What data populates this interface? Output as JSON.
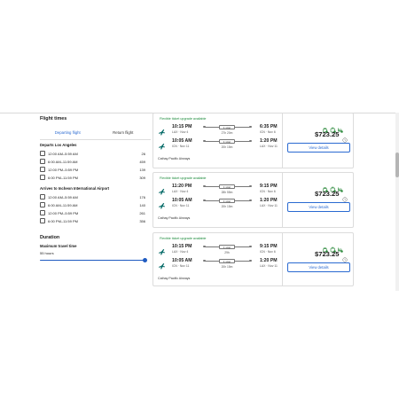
{
  "filters": {
    "flight_times_title": "Flight times",
    "tabs": [
      {
        "label": "Departing flight",
        "active": true
      },
      {
        "label": "Return flight",
        "active": false
      }
    ],
    "departs": {
      "label": "Departs Los Angeles",
      "options": [
        {
          "label": "12:00 AM–5:59 AM",
          "count": "26"
        },
        {
          "label": "6:00 AM–11:59 AM",
          "count": "459"
        },
        {
          "label": "12:00 PM–5:59 PM",
          "count": "139"
        },
        {
          "label": "6:00 PM–11:59 PM",
          "count": "309"
        }
      ]
    },
    "arrives": {
      "label": "Arrives to Incheon International Airport",
      "options": [
        {
          "label": "12:00 AM–5:59 AM",
          "count": "176"
        },
        {
          "label": "6:00 AM–11:59 AM",
          "count": "140"
        },
        {
          "label": "12:00 PM–5:59 PM",
          "count": "261"
        },
        {
          "label": "6:00 PM–11:59 PM",
          "count": "356"
        }
      ]
    },
    "duration": {
      "title": "Duration",
      "max_label": "Maximum travel time",
      "value_text": "55 hours",
      "slider_fraction": 1.0
    }
  },
  "flights": [
    {
      "upgrade": "Flexible ticket upgrade available",
      "outbound": {
        "dep_time": "10:15 PM",
        "dep_info": "LAX · Nov 4",
        "stops": "1 stop",
        "duration": "27h 20m",
        "arr_time": "6:35 PM",
        "arr_info": "ICN · Nov 6"
      },
      "inbound": {
        "dep_time": "10:05 AM",
        "dep_info": "ICN · Nov 11",
        "stops": "1 stop",
        "duration": "20h 15m",
        "arr_time": "1:20 PM",
        "arr_info": "LAX · Nov 11"
      },
      "airline": "Cathay Pacific Airways",
      "price": "$723.25",
      "button": "View details"
    },
    {
      "upgrade": "Flexible ticket upgrade available",
      "outbound": {
        "dep_time": "11:20 PM",
        "dep_info": "LAX · Nov 4",
        "stops": "1 stop",
        "duration": "28h 55m",
        "arr_time": "9:15 PM",
        "arr_info": "ICN · Nov 6"
      },
      "inbound": {
        "dep_time": "10:05 AM",
        "dep_info": "ICN · Nov 11",
        "stops": "1 stop",
        "duration": "20h 15m",
        "arr_time": "1:20 PM",
        "arr_info": "LAX · Nov 11"
      },
      "airline": "Cathay Pacific Airways",
      "price": "$723.25",
      "button": "View details"
    },
    {
      "upgrade": "Flexible ticket upgrade available",
      "outbound": {
        "dep_time": "10:15 PM",
        "dep_info": "LAX · Nov 4",
        "stops": "1 stop",
        "duration": "29h",
        "arr_time": "9:15 PM",
        "arr_info": "ICN · Nov 6"
      },
      "inbound": {
        "dep_time": "10:05 AM",
        "dep_info": "ICN · Nov 11",
        "stops": "1 stop",
        "duration": "20h 15m",
        "arr_time": "1:20 PM",
        "arr_info": "LAX · Nov 11"
      },
      "airline": "Cathay Pacific Airways",
      "price": "$723.25",
      "button": "View details"
    }
  ],
  "colors": {
    "accent": "#2a6ad1",
    "upgrade_green": "#1b8a3a",
    "amenity_green": "#2e8b3e",
    "logo_teal": "#0b6e6b"
  },
  "icons": {
    "airline_logo": "cathay-plane-logo-icon",
    "amenities": [
      "carry-on-bag-icon",
      "checked-bag-icon",
      "seat-bag-icon"
    ],
    "price_info": "clock-icon"
  }
}
